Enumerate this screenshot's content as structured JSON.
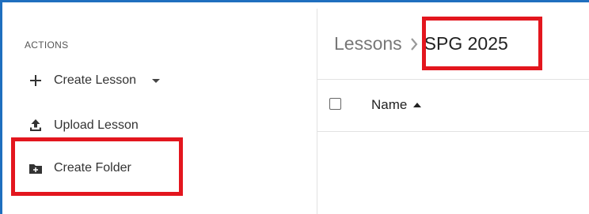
{
  "sidebar": {
    "heading": "ACTIONS",
    "items": [
      {
        "label": "Create Lesson",
        "icon": "plus-icon",
        "has_dropdown": true
      },
      {
        "label": "Upload Lesson",
        "icon": "upload-icon",
        "has_dropdown": false
      },
      {
        "label": "Create Folder",
        "icon": "folder-plus-icon",
        "has_dropdown": false
      }
    ]
  },
  "breadcrumb": {
    "parent": "Lessons",
    "current": "SPG 2025",
    "separator_icon": "chevron-right-icon"
  },
  "table": {
    "columns": [
      {
        "label": "Name",
        "sort": "ascending",
        "sort_icon": "sort-ascending-icon"
      }
    ]
  },
  "colors": {
    "highlight": "#e3161e",
    "frame_accent": "#1f6fbf"
  }
}
